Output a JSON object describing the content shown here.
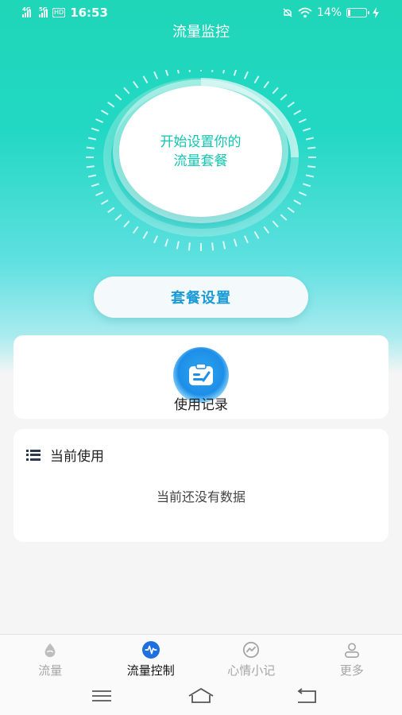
{
  "status_bar": {
    "time": "16:53",
    "network_1": "4G",
    "network_2": "5G",
    "hd_badge": "HD",
    "battery": "14%",
    "battery_level": 0.14
  },
  "header": {
    "title": "流量监控"
  },
  "dial": {
    "line1": "开始设置你的",
    "line2": "流量套餐"
  },
  "plan_button": {
    "label": "套餐设置"
  },
  "records": {
    "label": "使用记录",
    "icon": "clipboard-icon"
  },
  "current_usage": {
    "title": "当前使用",
    "empty_text": "当前还没有数据"
  },
  "tabs": [
    {
      "label": "流量",
      "icon": "drop-icon",
      "active": false
    },
    {
      "label": "流量控制",
      "icon": "pulse-icon",
      "active": true
    },
    {
      "label": "心情小记",
      "icon": "chart-circle-icon",
      "active": false
    },
    {
      "label": "更多",
      "icon": "user-icon",
      "active": false
    }
  ],
  "colors": {
    "accent": "#1fd6b8",
    "button_text": "#1a9bd6",
    "active_tab_icon": "#1f6fe0"
  }
}
